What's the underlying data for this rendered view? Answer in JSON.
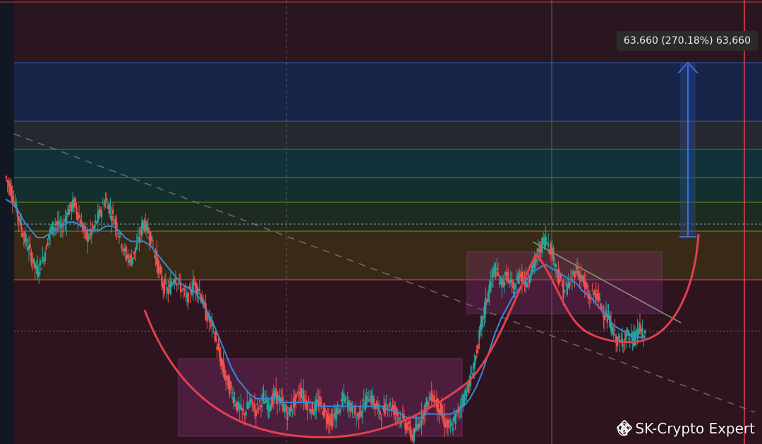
{
  "chart_data": {
    "type": "candlestick",
    "instrument_note": "",
    "measurement": {
      "label": "63.660 (270.18%) 63,660",
      "percent": 270.18
    },
    "ma_line_color": "#3b86d6",
    "cup_arc_color": "#e0404f",
    "candle_up_color": "#26a69a",
    "candle_down_color": "#ef5350",
    "fib_levels": [
      {
        "color": "#2a4fa0",
        "label": ""
      },
      {
        "color": "#555555",
        "label": ""
      },
      {
        "color": "#1f7a7a",
        "label": ""
      },
      {
        "color": "#2a7f5a",
        "label": ""
      },
      {
        "color": "#5a7a2a",
        "label": ""
      },
      {
        "color": "#8a6a1a",
        "label": ""
      },
      {
        "color": "#d03b4a",
        "label": ""
      }
    ],
    "price_series": [
      [
        0.72,
        0.66
      ],
      [
        0.68,
        0.6
      ],
      [
        0.62,
        0.58
      ],
      [
        0.56,
        0.52
      ],
      [
        0.52,
        0.47
      ],
      [
        0.47,
        0.5
      ],
      [
        0.5,
        0.57
      ],
      [
        0.57,
        0.6
      ],
      [
        0.6,
        0.58
      ],
      [
        0.58,
        0.63
      ],
      [
        0.63,
        0.65
      ],
      [
        0.65,
        0.6
      ],
      [
        0.6,
        0.56
      ],
      [
        0.56,
        0.58
      ],
      [
        0.58,
        0.62
      ],
      [
        0.62,
        0.66
      ],
      [
        0.66,
        0.62
      ],
      [
        0.62,
        0.58
      ],
      [
        0.58,
        0.52
      ],
      [
        0.52,
        0.5
      ],
      [
        0.5,
        0.54
      ],
      [
        0.54,
        0.6
      ],
      [
        0.6,
        0.57
      ],
      [
        0.57,
        0.51
      ],
      [
        0.51,
        0.44
      ],
      [
        0.44,
        0.42
      ],
      [
        0.42,
        0.46
      ],
      [
        0.46,
        0.43
      ],
      [
        0.43,
        0.4
      ],
      [
        0.4,
        0.44
      ],
      [
        0.44,
        0.42
      ],
      [
        0.42,
        0.36
      ],
      [
        0.36,
        0.33
      ],
      [
        0.33,
        0.26
      ],
      [
        0.26,
        0.2
      ],
      [
        0.2,
        0.16
      ],
      [
        0.16,
        0.12
      ],
      [
        0.12,
        0.1
      ],
      [
        0.1,
        0.13
      ],
      [
        0.13,
        0.11
      ],
      [
        0.11,
        0.14
      ],
      [
        0.14,
        0.12
      ],
      [
        0.12,
        0.15
      ],
      [
        0.15,
        0.13
      ],
      [
        0.13,
        0.1
      ],
      [
        0.1,
        0.13
      ],
      [
        0.13,
        0.16
      ],
      [
        0.16,
        0.13
      ],
      [
        0.13,
        0.11
      ],
      [
        0.11,
        0.13
      ],
      [
        0.13,
        0.1
      ],
      [
        0.1,
        0.08
      ],
      [
        0.08,
        0.11
      ],
      [
        0.11,
        0.14
      ],
      [
        0.14,
        0.12
      ],
      [
        0.12,
        0.09
      ],
      [
        0.09,
        0.12
      ],
      [
        0.12,
        0.15
      ],
      [
        0.15,
        0.12
      ],
      [
        0.12,
        0.1
      ],
      [
        0.1,
        0.13
      ],
      [
        0.13,
        0.11
      ],
      [
        0.11,
        0.09
      ],
      [
        0.09,
        0.07
      ],
      [
        0.07,
        0.04
      ],
      [
        0.04,
        0.08
      ],
      [
        0.08,
        0.12
      ],
      [
        0.12,
        0.15
      ],
      [
        0.15,
        0.12
      ],
      [
        0.12,
        0.08
      ],
      [
        0.08,
        0.06
      ],
      [
        0.06,
        0.1
      ],
      [
        0.1,
        0.14
      ],
      [
        0.14,
        0.18
      ],
      [
        0.18,
        0.25
      ],
      [
        0.25,
        0.34
      ],
      [
        0.34,
        0.42
      ],
      [
        0.42,
        0.48
      ],
      [
        0.48,
        0.44
      ],
      [
        0.44,
        0.46
      ],
      [
        0.46,
        0.42
      ],
      [
        0.42,
        0.47
      ],
      [
        0.47,
        0.44
      ],
      [
        0.44,
        0.48
      ],
      [
        0.48,
        0.52
      ],
      [
        0.52,
        0.56
      ],
      [
        0.56,
        0.53
      ],
      [
        0.53,
        0.47
      ],
      [
        0.47,
        0.42
      ],
      [
        0.42,
        0.44
      ],
      [
        0.44,
        0.48
      ],
      [
        0.48,
        0.45
      ],
      [
        0.45,
        0.4
      ],
      [
        0.4,
        0.42
      ],
      [
        0.42,
        0.38
      ],
      [
        0.38,
        0.35
      ],
      [
        0.35,
        0.31
      ],
      [
        0.31,
        0.28
      ],
      [
        0.28,
        0.31
      ],
      [
        0.31,
        0.29
      ],
      [
        0.29,
        0.32
      ],
      [
        0.32,
        0.3
      ],
      [
        0.3,
        0.31
      ]
    ],
    "ma_series": [
      0.66,
      0.65,
      0.63,
      0.6,
      0.58,
      0.56,
      0.56,
      0.57,
      0.58,
      0.59,
      0.6,
      0.6,
      0.59,
      0.58,
      0.58,
      0.58,
      0.59,
      0.59,
      0.58,
      0.56,
      0.55,
      0.55,
      0.55,
      0.54,
      0.52,
      0.5,
      0.48,
      0.46,
      0.44,
      0.43,
      0.42,
      0.4,
      0.37,
      0.34,
      0.3,
      0.26,
      0.22,
      0.19,
      0.17,
      0.15,
      0.14,
      0.14,
      0.14,
      0.14,
      0.13,
      0.13,
      0.13,
      0.13,
      0.13,
      0.13,
      0.12,
      0.12,
      0.12,
      0.12,
      0.12,
      0.12,
      0.12,
      0.12,
      0.12,
      0.12,
      0.12,
      0.11,
      0.11,
      0.1,
      0.09,
      0.09,
      0.09,
      0.1,
      0.1,
      0.1,
      0.1,
      0.1,
      0.11,
      0.12,
      0.14,
      0.17,
      0.21,
      0.26,
      0.31,
      0.35,
      0.38,
      0.41,
      0.43,
      0.45,
      0.47,
      0.48,
      0.49,
      0.48,
      0.47,
      0.46,
      0.45,
      0.44,
      0.42,
      0.41,
      0.39,
      0.37,
      0.35,
      0.33,
      0.32,
      0.31,
      0.3,
      0.3,
      0.3
    ]
  },
  "watermark": {
    "text": "@ SK-Crypto Expert"
  }
}
